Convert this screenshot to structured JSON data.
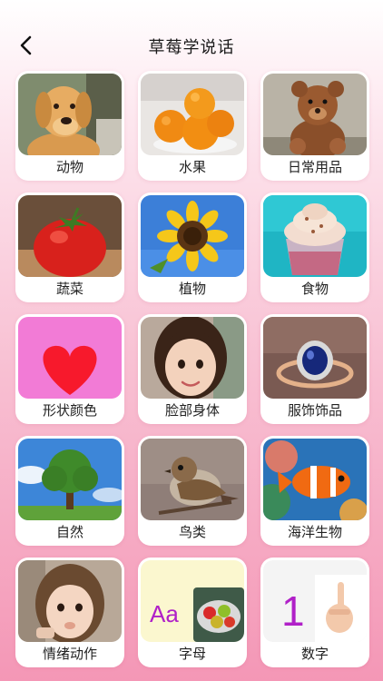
{
  "header": {
    "title": "草莓学说话"
  },
  "categories": [
    {
      "label": "动物",
      "icon": "dog-image"
    },
    {
      "label": "水果",
      "icon": "oranges-image"
    },
    {
      "label": "日常用品",
      "icon": "teddy-bear-image"
    },
    {
      "label": "蔬菜",
      "icon": "tomato-image"
    },
    {
      "label": "植物",
      "icon": "sunflower-image"
    },
    {
      "label": "食物",
      "icon": "ice-cream-image"
    },
    {
      "label": "形状颜色",
      "icon": "heart-image"
    },
    {
      "label": "脸部身体",
      "icon": "girl-face-image"
    },
    {
      "label": "服饰饰品",
      "icon": "ring-image"
    },
    {
      "label": "自然",
      "icon": "tree-image"
    },
    {
      "label": "鸟类",
      "icon": "sparrow-image"
    },
    {
      "label": "海洋生物",
      "icon": "clownfish-image"
    },
    {
      "label": "情绪动作",
      "icon": "girl-eating-image"
    },
    {
      "label": "字母",
      "icon": "letters-apples-image",
      "glyph": "Aa"
    },
    {
      "label": "数字",
      "icon": "number-hand-image",
      "glyph": "1"
    }
  ],
  "colors": {
    "accent_pink": "#f497b6",
    "shape_heart_red": "#f7192c",
    "shape_bg_pink": "#f27bd6",
    "letter_purple": "#b020c8"
  }
}
